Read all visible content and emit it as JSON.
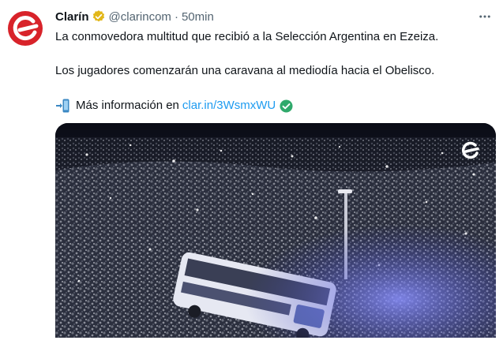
{
  "tweet": {
    "author_name": "Clarín",
    "handle": "@clarincom",
    "separator": "·",
    "time": "50min",
    "line1": "La conmovedora multitud que recibió a la Selección Argentina en Ezeiza.",
    "line2": "Los jugadores comenzarán una caravana al mediodía hacia el Obelisco.",
    "more_info_label": "Más información en",
    "link_text": "clar.in/3WsmxWU"
  },
  "icons": {
    "avatar": "clarin-logo",
    "verified": "gold-verified-badge-icon",
    "more": "more-dots-icon",
    "phone": "mobile-phone-arrow-icon",
    "check": "green-check-icon",
    "watermark": "clarin-watermark-icon"
  },
  "colors": {
    "brand_red": "#d8232a",
    "link": "#1d9bf0",
    "verified_gold": "#e2b719",
    "check_green": "#2fa96b",
    "muted": "#536471"
  }
}
